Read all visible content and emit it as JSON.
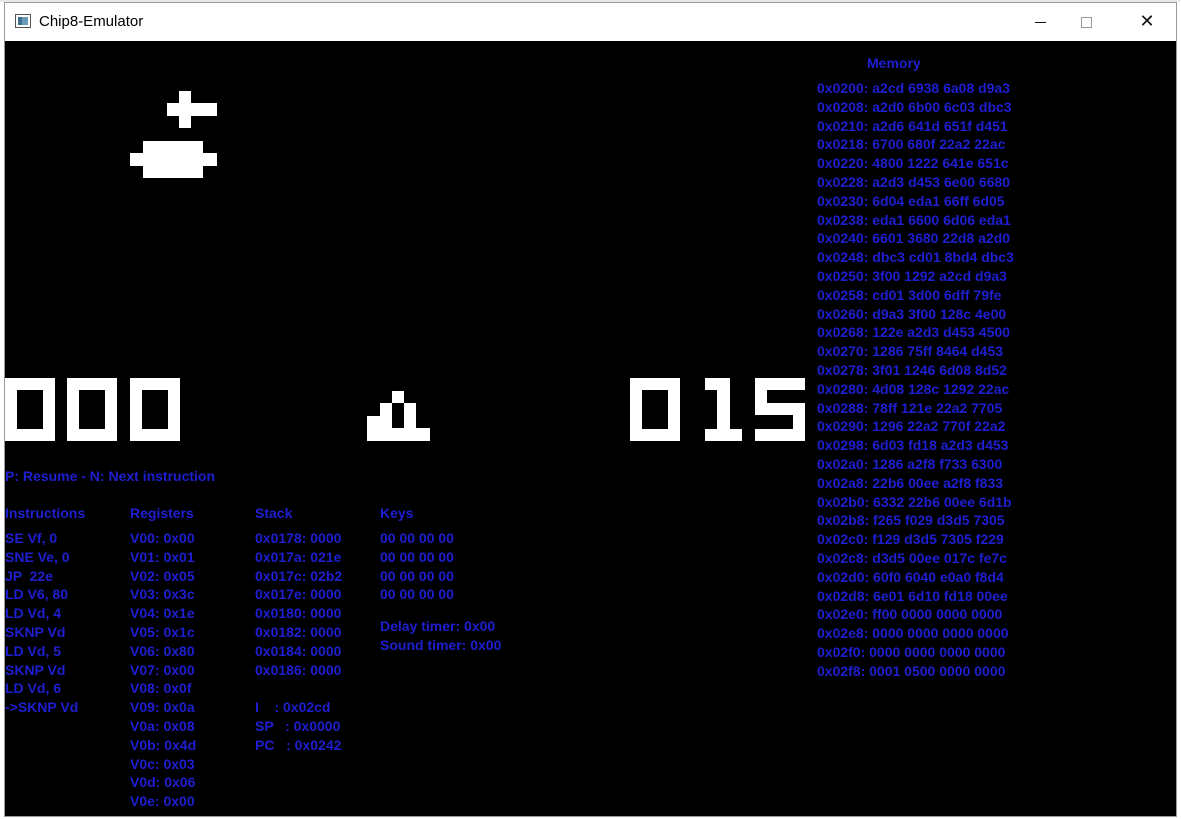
{
  "window": {
    "title": "Chip8-Emulator",
    "controls": [
      "minimize",
      "maximize",
      "close"
    ],
    "close_glyph": "✕"
  },
  "screen": {
    "score_left": "000",
    "score_right": "015",
    "hint": "P: Resume - N: Next instruction"
  },
  "debugger": {
    "instructions": {
      "header": "Instructions",
      "items": [
        "SE Vf, 0",
        "SNE Ve, 0",
        "JP  22e",
        "LD V6, 80",
        "LD Vd, 4",
        "SKNP Vd",
        "LD Vd, 5",
        "SKNP Vd",
        "LD Vd, 6",
        "->SKNP Vd"
      ]
    },
    "registers": {
      "header": "Registers",
      "items": [
        "V00: 0x00",
        "V01: 0x01",
        "V02: 0x05",
        "V03: 0x3c",
        "V04: 0x1e",
        "V05: 0x1c",
        "V06: 0x80",
        "V07: 0x00",
        "V08: 0x0f",
        "V09: 0x0a",
        "V0a: 0x08",
        "V0b: 0x4d",
        "V0c: 0x03",
        "V0d: 0x06",
        "V0e: 0x00"
      ]
    },
    "stack": {
      "header": "Stack",
      "items": [
        "0x0178: 0000",
        "0x017a: 021e",
        "0x017c: 02b2",
        "0x017e: 0000",
        "0x0180: 0000",
        "0x0182: 0000",
        "0x0184: 0000",
        "0x0186: 0000"
      ],
      "pointers": [
        "I    : 0x02cd",
        "SP   : 0x0000",
        "PC   : 0x0242"
      ]
    },
    "keys": {
      "header": "Keys",
      "items": [
        "00 00 00 00",
        "00 00 00 00",
        "00 00 00 00",
        "00 00 00 00"
      ],
      "delay_timer": "Delay timer: 0x00",
      "sound_timer": "Sound timer: 0x00"
    },
    "memory": {
      "header": "Memory",
      "items": [
        "0x0200: a2cd 6938 6a08 d9a3",
        "0x0208: a2d0 6b00 6c03 dbc3",
        "0x0210: a2d6 641d 651f d451",
        "0x0218: 6700 680f 22a2 22ac",
        "0x0220: 4800 1222 641e 651c",
        "0x0228: a2d3 d453 6e00 6680",
        "0x0230: 6d04 eda1 66ff 6d05",
        "0x0238: eda1 6600 6d06 eda1",
        "0x0240: 6601 3680 22d8 a2d0",
        "0x0248: dbc3 cd01 8bd4 dbc3",
        "0x0250: 3f00 1292 a2cd d9a3",
        "0x0258: cd01 3d00 6dff 79fe",
        "0x0260: d9a3 3f00 128c 4e00",
        "0x0268: 122e a2d3 d453 4500",
        "0x0270: 1286 75ff 8464 d453",
        "0x0278: 3f01 1246 6d08 8d52",
        "0x0280: 4d08 128c 1292 22ac",
        "0x0288: 78ff 121e 22a2 7705",
        "0x0290: 1296 22a2 770f 22a2",
        "0x0298: 6d03 fd18 a2d3 d453",
        "0x02a0: 1286 a2f8 f733 6300",
        "0x02a8: 22b6 00ee a2f8 f833",
        "0x02b0: 6332 22b6 00ee 6d1b",
        "0x02b8: f265 f029 d3d5 7305",
        "0x02c0: f129 d3d5 7305 f229",
        "0x02c8: d3d5 00ee 017c fe7c",
        "0x02d0: 60f0 6040 e0a0 f8d4",
        "0x02d8: 6e01 6d10 fd18 00ee",
        "0x02e0: ff00 0000 0000 0000",
        "0x02e8: 0000 0000 0000 0000",
        "0x02f0: 0000 0000 0000 0000",
        "0x02f8: 0001 0500 0000 0000"
      ]
    }
  },
  "colors": {
    "text_blue": "#1f1fd2",
    "pixel_on": "#ffffff",
    "background": "#000000"
  }
}
